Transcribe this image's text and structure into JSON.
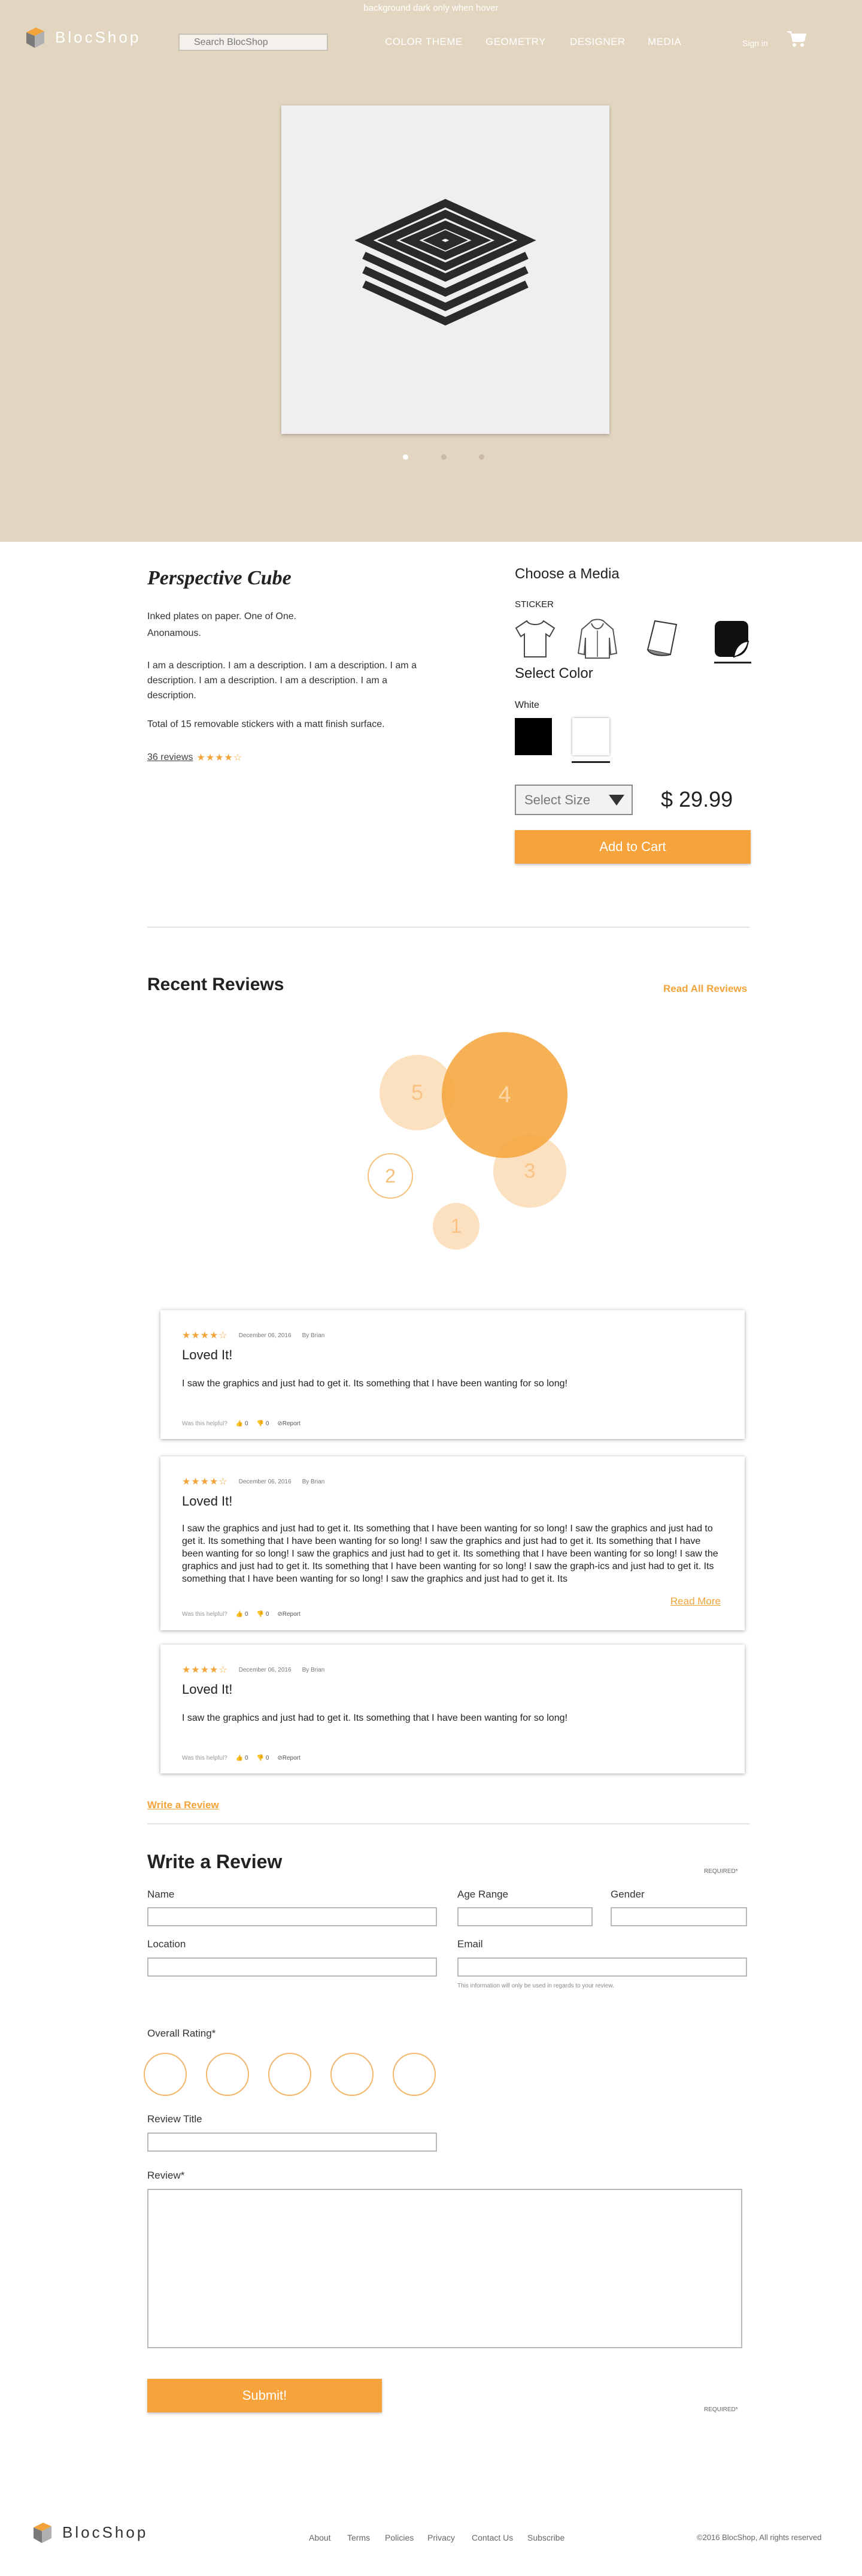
{
  "hero": {
    "top_note": "background dark only when hover",
    "logo": "BlocShop",
    "search_placeholder": "Search BlocShop",
    "nav": [
      "COLOR THEME",
      "GEOMETRY",
      "DESIGNER",
      "MEDIA"
    ],
    "signin": "Sign in",
    "background_color": "#e3d6c0",
    "carousel_active_index": 0,
    "carousel_count": 3
  },
  "product": {
    "title": "Perspective Cube",
    "line1": "Inked plates on paper. One of One.",
    "line2": "Anonamous.",
    "description": "I am a description. I am a description. I am a description. I am a description. I am a description. I am a description. I am a description.",
    "stickers_note": "Total of 15 removable stickers with a matt finish surface.",
    "reviews_count": "36 reviews",
    "rating": 4
  },
  "options": {
    "media_heading": "Choose a Media",
    "media_selected": "STICKER",
    "media_icons": [
      "tshirt-icon",
      "hoodie-icon",
      "paper-print-icon",
      "sticker-icon"
    ],
    "color_heading": "Select Color",
    "color_selected": "White",
    "colors": [
      "#000000",
      "#ffffff"
    ],
    "size_placeholder": "Select Size",
    "price": "$ 29.99",
    "add_to_cart": "Add to Cart",
    "accent_color": "#f5a33a"
  },
  "recent_reviews": {
    "title": "Recent Reviews",
    "read_all": "Read All Reviews",
    "bubbles": [
      "5",
      "4",
      "2",
      "3",
      "1"
    ]
  },
  "reviews": [
    {
      "rating": 4,
      "date": "December 06, 2016",
      "author": "By Brian",
      "title": "Loved It!",
      "body": "I saw the graphics and just had to get it. Its something that I have been wanting for so long!",
      "helpful_q": "Was this helpful?",
      "up": "0",
      "down": "0",
      "report": "Report",
      "read_more": ""
    },
    {
      "rating": 4,
      "date": "December 06, 2016",
      "author": "By Brian",
      "title": "Loved It!",
      "body": "I saw the graphics and just had to get it. Its something that I have been wanting for so long! I saw the graphics and just had to get it. Its something that I have been wanting for so long! I saw the graphics and just had to get it. Its something that I have been wanting for so long! I saw the graphics and just had to get it. Its something that I have been wanting for so long! I saw the graphics and just had to get it. Its something that I have been wanting for so long! I saw the graph-ics and just had to get it. Its something that I have been wanting for so long! I saw the graphics and just had to get it. Its",
      "helpful_q": "Was this helpful?",
      "up": "0",
      "down": "0",
      "report": "Report",
      "read_more": "Read More"
    },
    {
      "rating": 4,
      "date": "December 06, 2016",
      "author": "By Brian",
      "title": "Loved It!",
      "body": "I saw the graphics and just had to get it. Its something that I have been wanting for so long!",
      "helpful_q": "Was this helpful?",
      "up": "0",
      "down": "0",
      "report": "Report",
      "read_more": ""
    }
  ],
  "write_review_link": "Write a Review",
  "form": {
    "title": "Write a Review",
    "required": "REQUIRED*",
    "name": "Name",
    "age_range": "Age Range",
    "gender": "Gender",
    "location": "Location",
    "email": "Email",
    "email_help": "This information will only be used in regards to your review.",
    "overall_rating": "Overall Rating*",
    "review_title": "Review Title",
    "review": "Review*",
    "submit": "Submit!",
    "required_bottom": "REQUIRED*"
  },
  "footer": {
    "logo": "BlocShop",
    "links": [
      "About",
      "Terms",
      "Policies",
      "Privacy",
      "Contact Us",
      "Subscribe"
    ],
    "copyright": "©2016 BlocShop, All rights reserved"
  }
}
